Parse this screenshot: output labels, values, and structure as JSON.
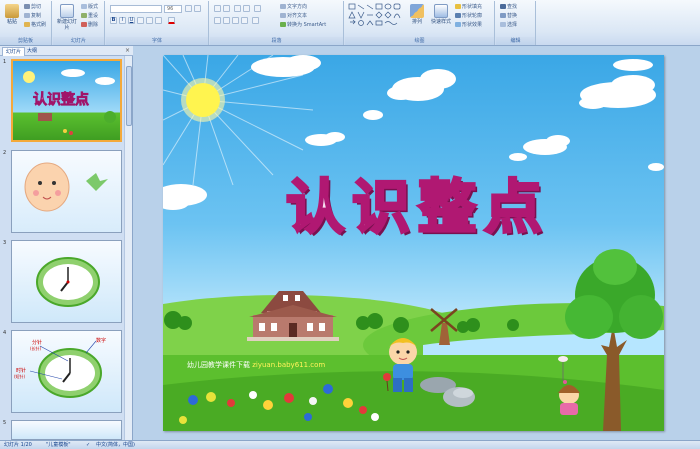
{
  "ribbon": {
    "clipboard": {
      "paste": "粘贴",
      "cut": "剪切",
      "copy": "复制",
      "format_painter": "格式刷",
      "label": "剪贴板"
    },
    "slides": {
      "new_slide": "新建幻灯片",
      "layout": "版式",
      "reset": "重设",
      "delete": "删除",
      "label": "幻灯片"
    },
    "font": {
      "size": "96",
      "label": "字体"
    },
    "paragraph": {
      "text_direction": "文字方向",
      "align_text": "对齐文本",
      "smartart": "转换为 SmartArt",
      "label": "段落"
    },
    "drawing": {
      "arrange": "排列",
      "quick_styles": "快速样式",
      "shape_fill": "形状填充",
      "shape_outline": "形状轮廓",
      "shape_effects": "形状效果",
      "label": "绘图"
    },
    "editing": {
      "find": "查找",
      "replace": "替换",
      "select": "选择",
      "label": "编辑"
    }
  },
  "panel": {
    "tabs": [
      "幻灯片",
      "大纲"
    ],
    "close": "×",
    "thumbnails": [
      {
        "num": "1"
      },
      {
        "num": "2"
      },
      {
        "num": "3"
      },
      {
        "num": "4",
        "label_a": "分针",
        "label_a2": "(长针)",
        "label_b": "数字",
        "label_c": "时针",
        "label_c2": "(短针)"
      },
      {
        "num": "5"
      }
    ]
  },
  "slide": {
    "title": "认识整点",
    "caption_prefix": "幼儿园教学课件下载",
    "caption_url": "ziyuan.baby611.com"
  },
  "status": {
    "slide_count": "幻灯片 1/20",
    "theme": "\"儿童模板\"",
    "language": "中文(简体，中国)"
  },
  "colors": {
    "ribbon_bg": "#dbe7f5",
    "title_fill": "#f7dff0",
    "title_stroke": "#b01872",
    "sky": "#3aa7e6",
    "grass": "#5cc12f",
    "selection": "#f4a93a"
  }
}
